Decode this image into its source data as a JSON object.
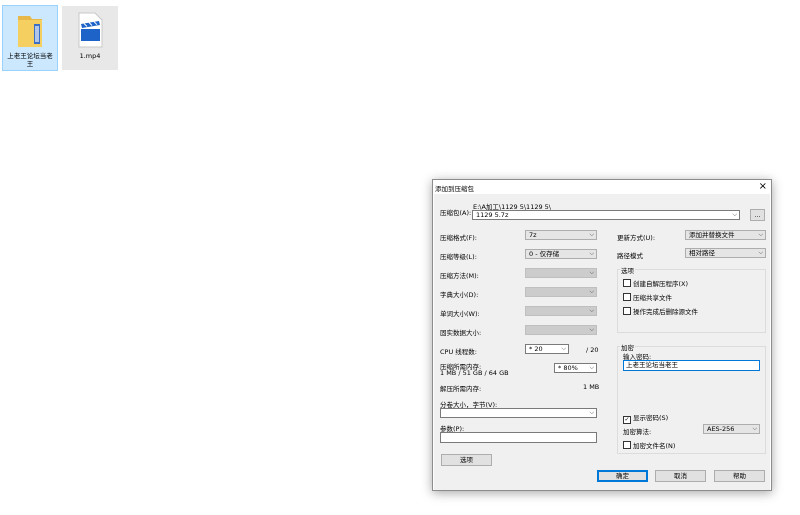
{
  "desktop": {
    "icons": [
      {
        "label": "上老王论坛当老王",
        "icon": "folder-icon"
      },
      {
        "label": "1.mp4",
        "icon": "video-file-icon"
      }
    ]
  },
  "dialog": {
    "title": "添加到压缩包",
    "close": "×",
    "archive": {
      "label": "压缩包(A):",
      "path": "E:\\A加工\\1129 5\\1129 5\\",
      "filename": "1129 5.7z",
      "browse": "..."
    },
    "left": {
      "format_label": "压缩格式(F):",
      "format_value": "7z",
      "level_label": "压缩等级(L):",
      "level_value": "0 - 仅存储",
      "method_label": "压缩方法(M):",
      "dict_label": "字典大小(D):",
      "word_label": "单词大小(W):",
      "solid_label": "固实数据大小:",
      "cpu_label": "CPU 线程数:",
      "cpu_value": "* 20",
      "cpu_total": "/ 20",
      "mem_label": "压缩所需内存:",
      "mem_detail": "1 MB / 51 GB / 64 GB",
      "mem_value": "* 80%",
      "decomp_label": "解压所需内存:",
      "decomp_value": "1 MB",
      "split_label": "分卷大小，字节(V):",
      "split_value": "",
      "params_label": "参数(P):",
      "params_value": "",
      "options_button": "选项"
    },
    "right": {
      "update_label": "更新方式(U):",
      "update_value": "添加并替换文件",
      "path_label": "路径模式",
      "path_value": "相对路径",
      "options_title": "选项",
      "opt_sfx": "创建自解压程序(X)",
      "opt_shared": "压缩共享文件",
      "opt_delete": "操作完成后删除源文件",
      "enc_title": "加密",
      "pwd_label": "输入密码:",
      "pwd_value": "上老王论坛当老王",
      "show_pwd": "显示密码(S)",
      "show_pwd_checked": "✓",
      "enc_method_label": "加密算法:",
      "enc_method_value": "AES-256",
      "enc_names": "加密文件名(N)"
    },
    "buttons": {
      "ok": "确定",
      "cancel": "取消",
      "help": "帮助"
    }
  }
}
